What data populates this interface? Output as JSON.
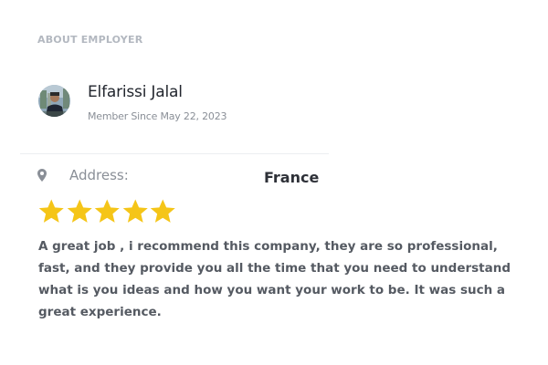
{
  "section": {
    "heading": "ABOUT EMPLOYER"
  },
  "employer": {
    "name": "Elfarissi Jalal",
    "member_since": "Member Since May 22, 2023",
    "avatar_icon": "user-avatar-photo"
  },
  "address": {
    "icon": "map-pin-icon",
    "label": "Address:",
    "value": "France"
  },
  "rating": {
    "stars": 5,
    "max_stars": 5,
    "star_color": "#f5c518"
  },
  "review": {
    "text": "A great job , i recommend this company, they are so professional, fast, and they provide you all the time that you need to understand what is you ideas and how you want your work to be. It was such a great experience."
  },
  "colors": {
    "heading": "#b3b8c0",
    "name": "#22262e",
    "muted": "#8a8f97",
    "body": "#555a62"
  }
}
